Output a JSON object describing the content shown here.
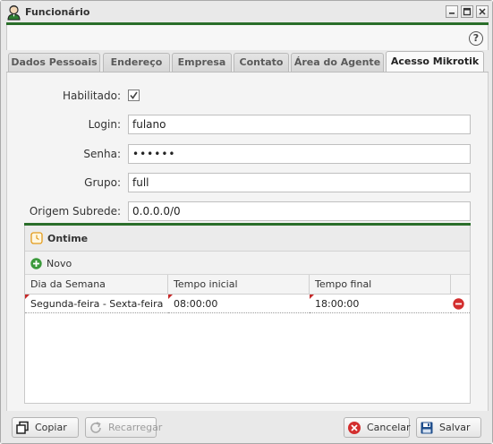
{
  "window": {
    "title": "Funcionário",
    "icon": "employee-icon",
    "controls": [
      "minimize-icon",
      "maximize-icon",
      "close-icon"
    ]
  },
  "toolbar": {
    "help_label": "?"
  },
  "tabs": [
    {
      "label": "Dados Pessoais",
      "active": false
    },
    {
      "label": "Endereço",
      "active": false
    },
    {
      "label": "Empresa",
      "active": false
    },
    {
      "label": "Contato",
      "active": false
    },
    {
      "label": "Área do Agente",
      "active": false
    },
    {
      "label": "Acesso Mikrotik",
      "active": true
    }
  ],
  "form": {
    "habilitado": {
      "label": "Habilitado:",
      "checked": true
    },
    "login": {
      "label": "Login:",
      "value": "fulano"
    },
    "senha": {
      "label": "Senha:",
      "value": "••••••"
    },
    "grupo": {
      "label": "Grupo:",
      "value": "full"
    },
    "origem": {
      "label": "Origem Subrede:",
      "value": "0.0.0.0/0"
    }
  },
  "ontime": {
    "title": "Ontime",
    "add_label": "Novo",
    "columns": [
      "Dia da Semana",
      "Tempo inicial",
      "Tempo final"
    ],
    "rows": [
      {
        "dia": "Segunda-feira - Sexta-feira",
        "inicio": "08:00:00",
        "fim": "18:00:00"
      }
    ]
  },
  "footer": {
    "copy_label": "Copiar",
    "reload_label": "Recarregar",
    "cancel_label": "Cancelar",
    "save_label": "Salvar"
  },
  "colors": {
    "accent_green": "#2a6e2a",
    "cancel_red": "#d32f2f",
    "save_blue": "#1f4e8c",
    "add_green": "#3c9a3c"
  }
}
